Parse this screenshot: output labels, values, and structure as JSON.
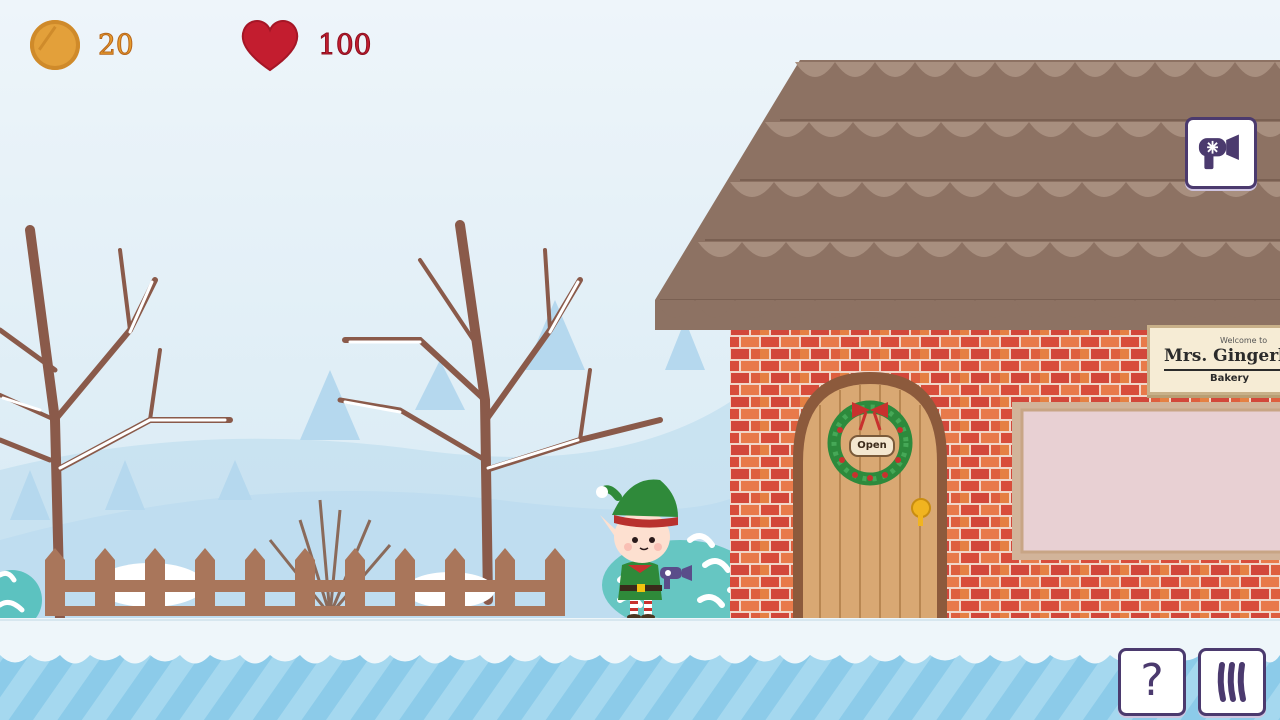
{
  "hud": {
    "coins": "20",
    "health": "100",
    "coin_icon": "coin-icon",
    "heart_icon": "heart-icon",
    "colors": {
      "coin": "#e3a03a",
      "heart": "#c31d2f"
    }
  },
  "shop": {
    "welcome": "Welcome to",
    "name": "Mrs. Gingerbre",
    "type": "Bakery",
    "door_sign": "Open"
  },
  "buttons": {
    "tool_icon": "hairdryer-icon",
    "help_label": "?",
    "pause_icon": "pause-icon"
  }
}
